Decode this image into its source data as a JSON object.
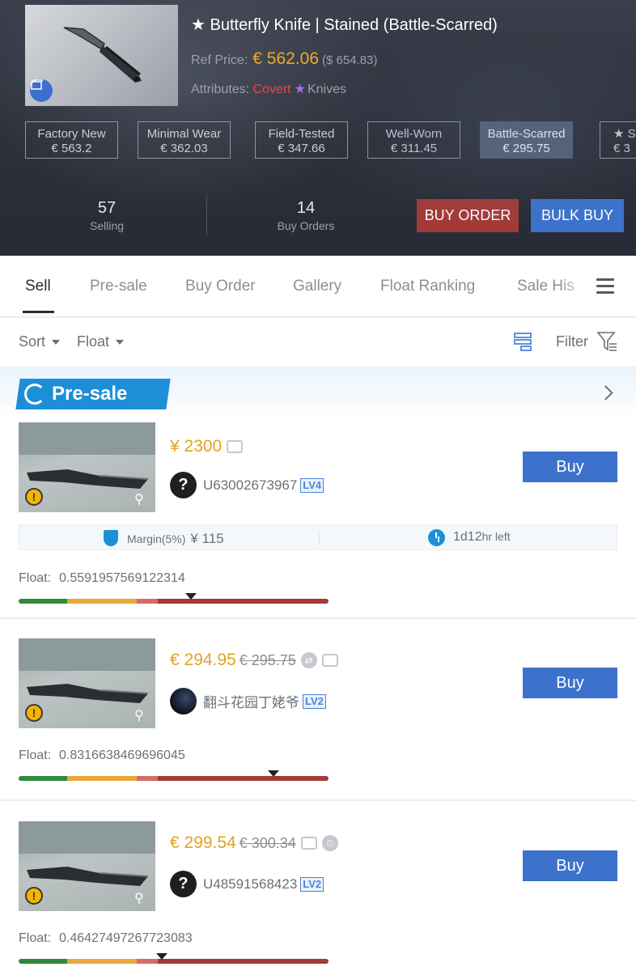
{
  "item": {
    "title": "★ Butterfly Knife | Stained (Battle-Scarred)",
    "ref_label": "Ref Price:",
    "ref_eur": "€ 562.06",
    "ref_usd": "($ 654.83)",
    "attr_label": "Attributes:",
    "attr_rarity": "Covert",
    "attr_star": "★",
    "attr_type": "Knives"
  },
  "wears": [
    {
      "name": "Factory New",
      "price": "€ 563.2"
    },
    {
      "name": "Minimal Wear",
      "price": "€ 362.03"
    },
    {
      "name": "Field-Tested",
      "price": "€ 347.66"
    },
    {
      "name": "Well-Worn",
      "price": "€ 311.45"
    },
    {
      "name": "Battle-Scarred",
      "price": "€ 295.75"
    },
    {
      "name": "★ St",
      "price": "€ 3"
    }
  ],
  "stats": {
    "selling_count": "57",
    "selling_label": "Selling",
    "orders_count": "14",
    "orders_label": "Buy Orders"
  },
  "actions": {
    "buy_order": "BUY ORDER",
    "bulk_buy": "BULK BUY"
  },
  "tabs": [
    "Sell",
    "Pre-sale",
    "Buy Order",
    "Gallery",
    "Float Ranking",
    "Sale His"
  ],
  "sortbar": {
    "sort": "Sort",
    "float": "Float",
    "filter": "Filter"
  },
  "presale": {
    "label": "Pre-sale"
  },
  "listings": [
    {
      "price": "¥ 2300",
      "old_price": "",
      "seller": "U63002673967",
      "level": "LV4",
      "avatar": "?",
      "margin_label": "Margin(5%)",
      "margin_value": "¥ 115",
      "time_left_main": "1d12",
      "time_left_unit": "hr left",
      "float_label": "Float:",
      "float_value": "0.5591957569122314",
      "buy": "Buy"
    },
    {
      "price": "€ 294.95",
      "old_price": "€ 295.75",
      "seller": "翻斗花园丁姥爷",
      "level": "LV2",
      "avatar": "",
      "float_label": "Float:",
      "float_value": "0.8316638469696045",
      "buy": "Buy"
    },
    {
      "price": "€ 299.54",
      "old_price": "€ 300.34",
      "seller": "U48591568423",
      "level": "LV2",
      "avatar": "?",
      "float_label": "Float:",
      "float_value": "0.46427497267723083",
      "buy": "Buy"
    }
  ],
  "colors": {
    "accent_blue": "#3d72cc",
    "order_red": "#a33a38",
    "price_gold": "#e3a222",
    "covert_red": "#e8484a",
    "float_fn": "#2f8a3c",
    "float_mw": "#6fb74a",
    "float_ft": "#e8a93a",
    "float_ww": "#d86a6a",
    "float_bs": "#a33a38"
  }
}
